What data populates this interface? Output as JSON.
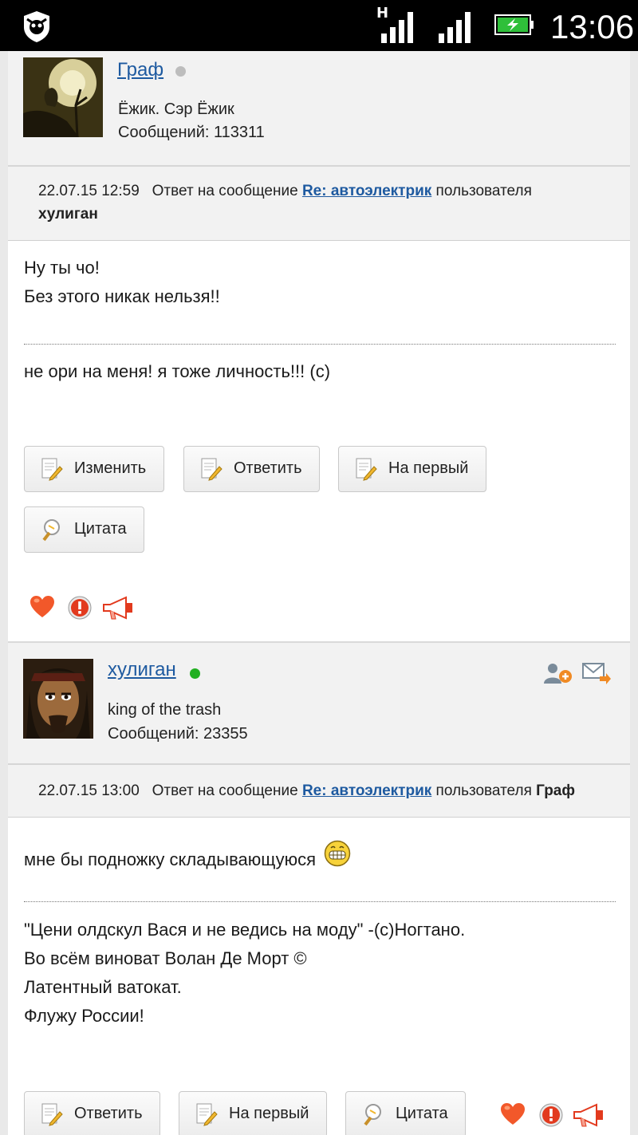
{
  "status_bar": {
    "network_label": "H",
    "time": "13:06"
  },
  "posts": [
    {
      "author": {
        "name": "Граф",
        "status_color": "#bdbdbd",
        "title": "Ёжик. Сэр Ёжик",
        "count_text": "Сообщений: 113311"
      },
      "meta": {
        "datetime": "22.07.15 12:59",
        "reply_prefix": "Ответ на сообщение",
        "reply_link": "Re: автоэлектрик",
        "reply_suffix": "пользователя",
        "reply_user": "хулиган"
      },
      "body_lines": [
        "Ну ты чо!",
        "Без этого никак нельзя!!"
      ],
      "signature_lines": [
        "не ори на меня! я тоже личность!!! (c)"
      ],
      "buttons": [
        {
          "label": "Изменить",
          "icon": "edit-icon"
        },
        {
          "label": "Ответить",
          "icon": "reply-icon"
        },
        {
          "label": "На первый",
          "icon": "first-post-icon"
        },
        {
          "label": "Цитата",
          "icon": "quote-icon"
        }
      ]
    },
    {
      "author": {
        "name": "хулиган",
        "status_color": "#22b022",
        "title": "king of the trash",
        "count_text": "Сообщений: 23355"
      },
      "meta": {
        "datetime": "22.07.15 13:00",
        "reply_prefix": "Ответ на сообщение",
        "reply_link": "Re: автоэлектрик",
        "reply_suffix": "пользователя",
        "reply_user": "Граф"
      },
      "body_lines": [
        "мне бы подножку складывающуюся"
      ],
      "signature_lines": [
        "\"Цени олдскул Вася и не ведись на моду\" -(с)Ногтано.",
        "Во всём виноват Волан Де Морт ©",
        "Латентный ватокат.",
        "Флужу России!"
      ],
      "buttons": [
        {
          "label": "Ответить",
          "icon": "reply-icon"
        },
        {
          "label": "На первый",
          "icon": "first-post-icon"
        },
        {
          "label": "Цитата",
          "icon": "quote-icon"
        }
      ]
    }
  ]
}
